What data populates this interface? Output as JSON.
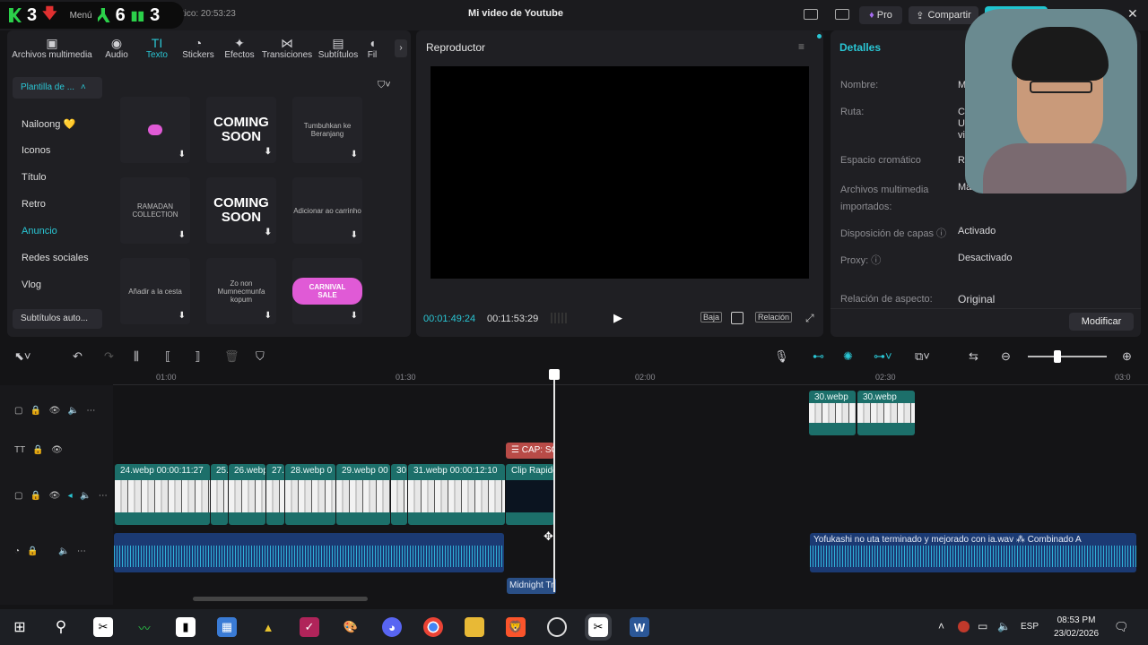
{
  "window": {
    "title": "Mi video de Youtube",
    "autosave": "ado automático: 20:53:23",
    "menu": "Menú",
    "pro": "Pro",
    "share": "Compartir"
  },
  "overlay": {
    "stat1": "3",
    "stat2": "6",
    "stat3": "3"
  },
  "tabs": [
    {
      "icon": "▣",
      "label": "Archivos multimedia"
    },
    {
      "icon": "◉",
      "label": "Audio"
    },
    {
      "icon": "TI",
      "label": "Texto"
    },
    {
      "icon": "◔",
      "label": "Stickers"
    },
    {
      "icon": "✦",
      "label": "Efectos"
    },
    {
      "icon": "⋈",
      "label": "Transiciones"
    },
    {
      "icon": "▤",
      "label": "Subtítulos"
    },
    {
      "icon": "◖",
      "label": "Fil"
    }
  ],
  "categories": {
    "header": "Plantilla de ...",
    "items": [
      "Nailoong 💛",
      "Iconos",
      "Título",
      "Retro",
      "Anuncio",
      "Redes sociales",
      "Vlog"
    ],
    "auto_subs": "Subtítulos auto..."
  },
  "templates": [
    {
      "text": "",
      "style": "pink"
    },
    {
      "text": "COMING SOON",
      "style": "big"
    },
    {
      "text": "Tumbuhkan ke Beranjang",
      "style": "small"
    },
    {
      "text": "RAMADAN COLLECTION",
      "style": "small"
    },
    {
      "text": "COMING SOON",
      "style": "big"
    },
    {
      "text": "Adicionar ao carrinho",
      "style": "small"
    },
    {
      "text": "Añadir a la cesta",
      "style": "small"
    },
    {
      "text": "Zo non Mumnecmunfa kopum",
      "style": "small"
    },
    {
      "text": "CARNIVAL SALE",
      "style": "pink"
    }
  ],
  "player": {
    "title": "Reproductor",
    "current_time": "00:01:49:24",
    "total_time": "00:11:53:29",
    "quality": "Baja",
    "ratio": "Relación"
  },
  "details": {
    "title": "Detalles",
    "rows": [
      {
        "label": "Nombre:",
        "value": "M"
      },
      {
        "label": "Ruta:",
        "value": "C\nU\nvi"
      },
      {
        "label": "Espacio cromático",
        "value": "Re"
      },
      {
        "label": "Archivos multimedia importados:",
        "value": "Manten..."
      },
      {
        "label": "Disposición de capas",
        "value": "Activado"
      },
      {
        "label": "Proxy:",
        "value": "Desactivado"
      },
      {
        "label": "Relación de aspecto:",
        "value": "Original"
      }
    ],
    "modify": "Modificar"
  },
  "timeline": {
    "ticks": [
      "01:00",
      "01:30",
      "02:00",
      "02:30",
      "03:0"
    ],
    "caption_clip": "CAP: SC",
    "video_clips": [
      {
        "label": "24.webp  00:00:11:27"
      },
      {
        "label": "25."
      },
      {
        "label": "26.webp"
      },
      {
        "label": "27."
      },
      {
        "label": "28.webp  0"
      },
      {
        "label": "29.webp  00"
      },
      {
        "label": "30."
      },
      {
        "label": "31.webp  00:00:12:10"
      },
      {
        "label": "Clip Rapido"
      }
    ],
    "top_clips": [
      {
        "label": "30.webp"
      },
      {
        "label": "30.webp"
      }
    ],
    "audio_clips": [
      {
        "label": ""
      },
      {
        "label": "Yofukashi no uta terminado y mejorado con ia.wav   ⁂ Combinado A"
      }
    ],
    "midnight_clip": "Midnight Tr"
  },
  "taskbar": {
    "time": "08:53 PM",
    "date": "23/02/2026",
    "lang": "ESP"
  },
  "colors": {
    "accent": "#2ac6d4",
    "video_clip": "#1c6f6a",
    "audio_clip": "#1b3a73",
    "caption_clip": "#b84b47"
  }
}
